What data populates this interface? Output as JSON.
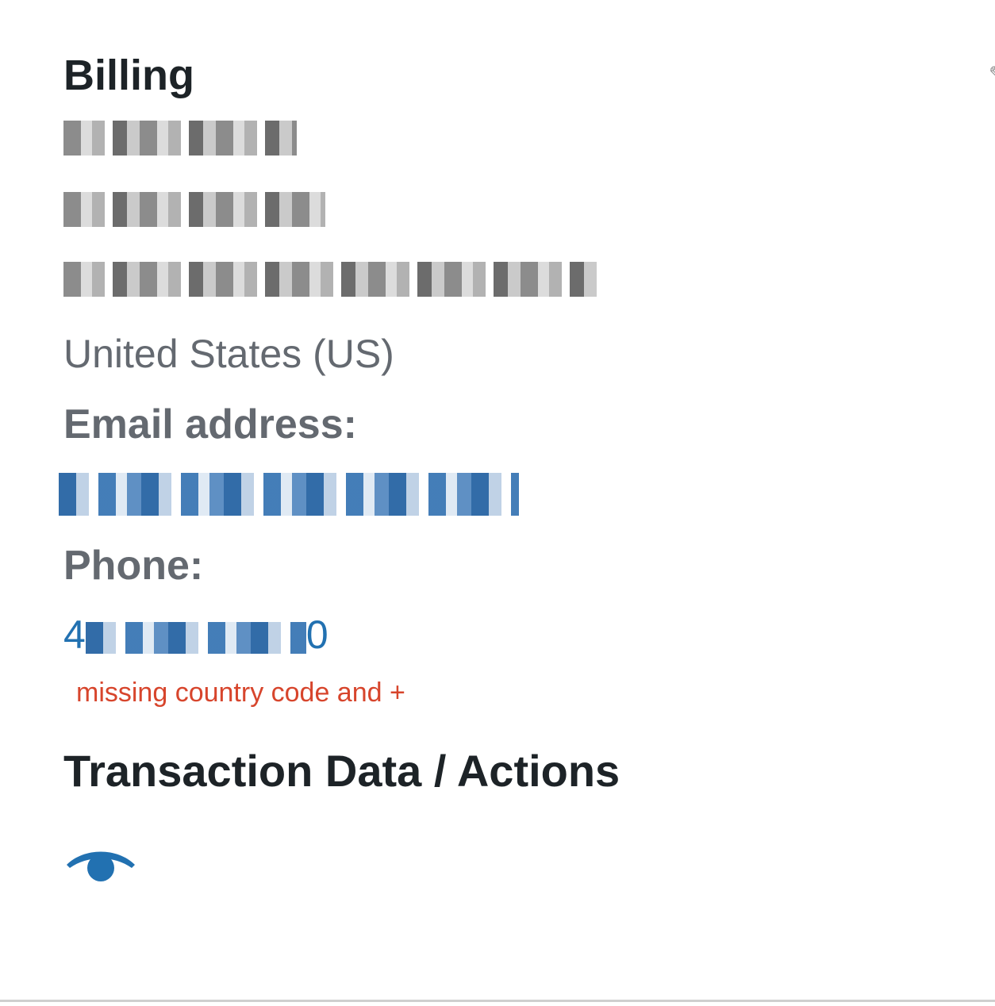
{
  "billing": {
    "title": "Billing",
    "address": {
      "name_redacted": "",
      "street_redacted": "",
      "city_redacted": "",
      "country": "United States (US)"
    },
    "email": {
      "label": "Email address:",
      "value_redacted": ""
    },
    "phone": {
      "label": "Phone:",
      "prefix": "4",
      "suffix": "0",
      "note": "missing country code and +"
    }
  },
  "transactions": {
    "title": "Transaction Data / Actions",
    "view_icon": "eye-icon"
  },
  "colors": {
    "heading": "#1d2327",
    "muted_text": "#646970",
    "link": "#2271b1",
    "note": "#d7452c"
  }
}
